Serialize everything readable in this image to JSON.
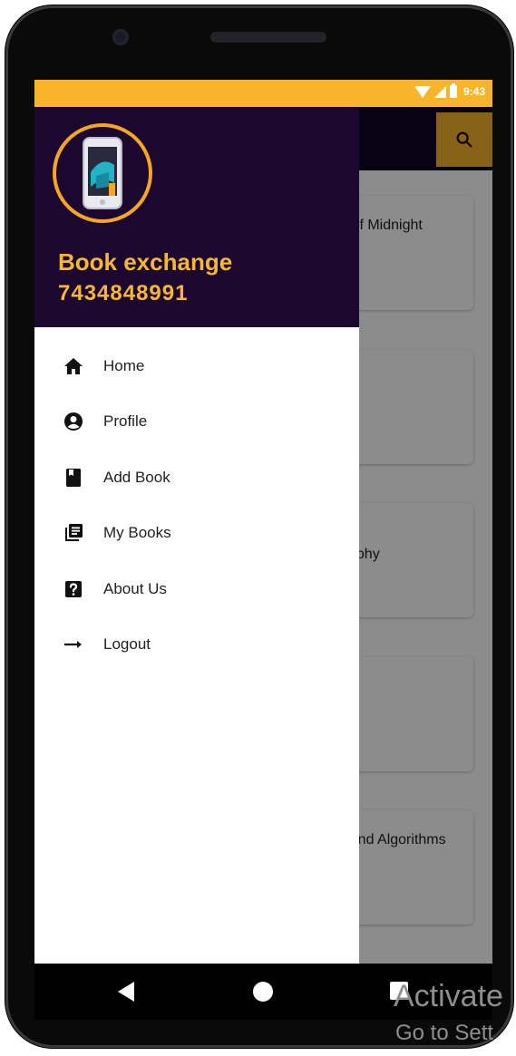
{
  "status_bar": {
    "time": "9:43",
    "color": "#f8b52b"
  },
  "app": {
    "search_icon": "search-icon",
    "cards": [
      {
        "title": "Of Midnight"
      },
      {
        "title": ""
      },
      {
        "title": "aphy"
      },
      {
        "title": ""
      },
      {
        "title": "And Algorithms"
      }
    ]
  },
  "drawer": {
    "header": {
      "app_name": "Book exchange",
      "phone_number": "7434848991",
      "background": "#1c0731",
      "accent": "#f7b634"
    },
    "items": [
      {
        "label": "Home",
        "icon": "home-icon"
      },
      {
        "label": "Profile",
        "icon": "account-circle-icon"
      },
      {
        "label": "Add Book",
        "icon": "book-icon"
      },
      {
        "label": "My Books",
        "icon": "library-books-icon"
      },
      {
        "label": "About Us",
        "icon": "help-icon"
      },
      {
        "label": "Logout",
        "icon": "arrow-right-icon"
      }
    ]
  },
  "watermark": {
    "line1": "Activate",
    "line2": "Go to Sett"
  }
}
